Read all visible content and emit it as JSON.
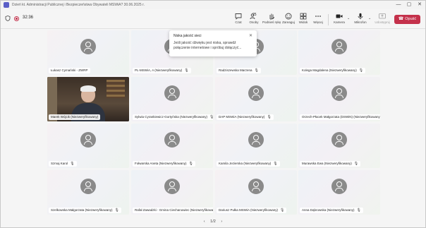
{
  "window": {
    "title": "Dzień kt. Administracji Publicznej i Bezpieczeństwa Obywateli MSWiA? 30.06.2025 r.",
    "minimize": "—",
    "maximize": "▢",
    "close": "✕"
  },
  "toolbar": {
    "timer": "32:36",
    "chat_label": "Czat",
    "people_label": "Osoby",
    "people_count": "25",
    "raise_label": "Podnieś rękę",
    "react_label": "Zareaguj",
    "view_label": "Widok",
    "more_label": "Więcej",
    "camera_label": "Kamera",
    "mic_label": "Mikrofon",
    "share_label": "Udostępnij",
    "leave_label": "Opuść"
  },
  "popup": {
    "title": "Niska jakość sieci",
    "body": "Jeśli jakość dźwięku jest niska, sprawdź połączenie internetowe i spróbuj dołączyć..."
  },
  "participants": [
    {
      "name": "Łukasz Cymański - ZWRP",
      "muted": false
    },
    {
      "name": "PL-MSWiA, A (Niezweryfikowany)",
      "muted": true
    },
    {
      "name": "Radziszewska Marzena",
      "muted": true
    },
    {
      "name": "Kolega Magdalena (Niezweryfikowany)",
      "muted": true
    },
    {
      "name": "Marek Wójcik (Niezweryfikowany)",
      "muted": false,
      "video": true
    },
    {
      "name": "Sylwia Cyrankiewicz-Gortyńska (Niezweryfikowany)",
      "muted": true
    },
    {
      "name": "DAP MSWiA (Niezweryfikowany)",
      "muted": true
    },
    {
      "name": "Orzech-Płacek Małgorzata (DSWiN) (Niezweryfikowany)",
      "muted": true
    },
    {
      "name": "Szmaj Karol",
      "muted": true
    },
    {
      "name": "Fołwarska Aneta (Niezweryfikowany)",
      "muted": true
    },
    {
      "name": "Kamila Jezierska (Niezweryfikowany)",
      "muted": true
    },
    {
      "name": "Murawska Ewa (Niezweryfikowany)",
      "muted": true
    },
    {
      "name": "Szelkowska Małgorzata (Niezweryfikowany)",
      "muted": true
    },
    {
      "name": "Rafał Zawadzki - Gmina Ciechanowiec (Niezweryfikowany)",
      "muted": true
    },
    {
      "name": "Dariusz Pułka MSWiA (Niezweryfikowany)",
      "muted": true
    },
    {
      "name": "Anna Dąbrowska (Niezweryfikowany)",
      "muted": true
    }
  ],
  "pager": {
    "prev": "‹",
    "label": "1/2",
    "next": "›"
  }
}
